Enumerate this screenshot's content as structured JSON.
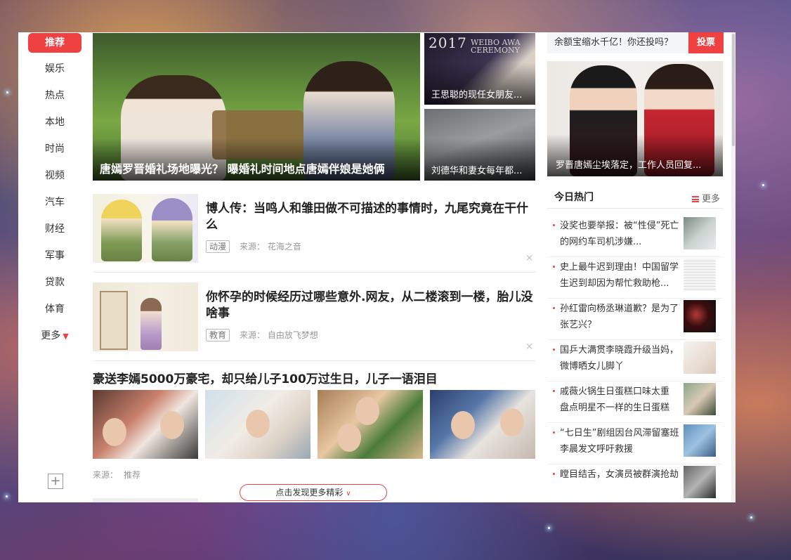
{
  "nav": {
    "items": [
      {
        "label": "推荐",
        "active": true
      },
      {
        "label": "娱乐"
      },
      {
        "label": "热点"
      },
      {
        "label": "本地"
      },
      {
        "label": "时尚"
      },
      {
        "label": "视频"
      },
      {
        "label": "汽车"
      },
      {
        "label": "财经"
      },
      {
        "label": "军事"
      },
      {
        "label": "贷款"
      },
      {
        "label": "体育"
      }
    ],
    "more_label": "更多",
    "add_icon": "plus-icon"
  },
  "hero": {
    "main_caption": "唐嫣罗晋婚礼场地曝光？ 曝婚礼时间地点唐嫣伴娘是她俩",
    "side1_caption": "王思聪的现任女朋友...",
    "side1_watermark_year": "2017",
    "side1_watermark_line1": "WEIBO AWA",
    "side1_watermark_line2": "CEREMONY",
    "side2_caption": "刘德华和妻女每年都..."
  },
  "articles": [
    {
      "title": "博人传：当鸣人和雏田做不可描述的事情时，九尾究竟在干什么",
      "tag": "动漫",
      "source_label": "来源：",
      "source": "花海之音",
      "close": "×"
    },
    {
      "title": "你怀孕的时候经历过哪些意外.网友，从二楼滚到一楼，胎儿没啥事",
      "tag": "教育",
      "source_label": "来源：",
      "source": "自由放飞梦想",
      "close": "×"
    }
  ],
  "gallery": {
    "headline": "豪送李嫣5000万豪宅，却只给儿子100万过生日，儿子一语泪目",
    "source_label": "来源：",
    "source": "推荐"
  },
  "load_more": {
    "label": "点击发现更多精彩"
  },
  "poll": {
    "question": "余额宝缩水千亿！你还投吗？",
    "vote_label": "投票"
  },
  "right_hero": {
    "caption": "罗晋唐嫣尘埃落定，工作人员回复..."
  },
  "hot": {
    "title": "今日热门",
    "more_label": "更多",
    "items": [
      {
        "text": "没奖也要举报：被“性侵”死亡的网约车司机涉嫌..."
      },
      {
        "text": "史上最牛迟到理由！中国留学生迟到却因为帮忙救助枪..."
      },
      {
        "text": "孙红雷向杨丞琳道歉？是为了张艺兴？"
      },
      {
        "text": "国乒大满贯李晓霞升级当妈，微博晒女儿脚丫"
      },
      {
        "text": "戚薇火锅生日蛋糕口味太重 盘点明星不一样的生日蛋糕"
      },
      {
        "text": "“七日生”剧组因台风滞留塞班 李晨发文呼吁救援"
      },
      {
        "text": "瞠目结舌，女演员被群演抢劫"
      }
    ]
  },
  "colors": {
    "accent": "#f04142",
    "text": "#222222",
    "muted": "#999999"
  }
}
